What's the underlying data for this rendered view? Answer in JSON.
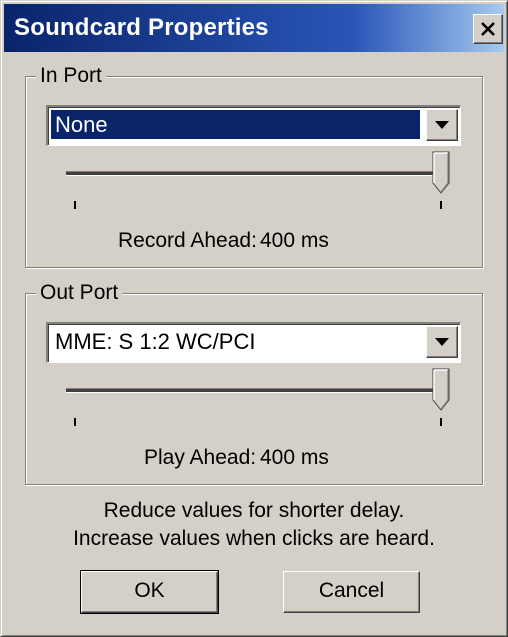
{
  "window": {
    "title": "Soundcard Properties"
  },
  "in_port": {
    "group_label": "In Port",
    "selected_device": "None",
    "slider_value_ms": 400,
    "ahead_label": "Record Ahead:",
    "ahead_value": "400 ms"
  },
  "out_port": {
    "group_label": "Out Port",
    "selected_device": "MME: S 1:2 WC/PCI",
    "slider_value_ms": 400,
    "ahead_label": "Play Ahead:",
    "ahead_value": "400 ms"
  },
  "hint": {
    "line1": "Reduce values for shorter delay.",
    "line2": "Increase values when clicks are heard."
  },
  "buttons": {
    "ok": "OK",
    "cancel": "Cancel"
  },
  "icons": {
    "close": "close-icon",
    "dropdown": "chevron-down-icon"
  },
  "colors": {
    "title_bar": "#0a246a",
    "selection": "#0a246a",
    "face": "#d4d0c8"
  }
}
